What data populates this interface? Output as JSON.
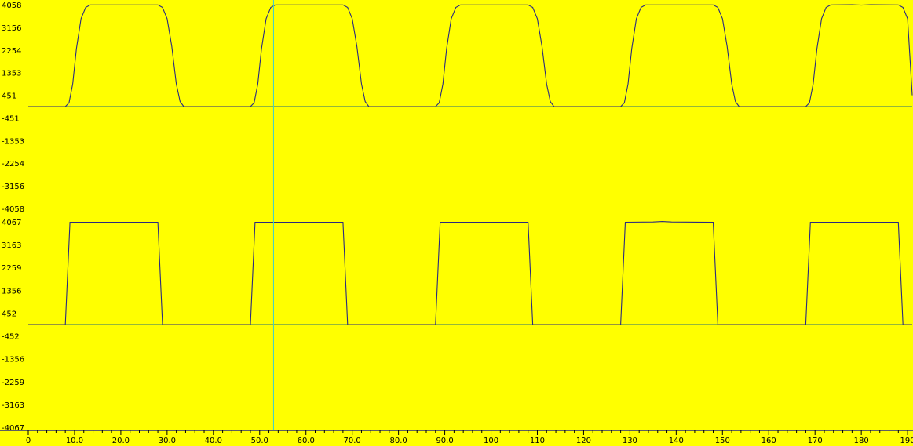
{
  "chart_data": {
    "type": "line",
    "x": {
      "range": [
        0,
        191
      ],
      "ticks": [
        0,
        10,
        20,
        30,
        40,
        50,
        60,
        70,
        80,
        90,
        100,
        110,
        120,
        130,
        140,
        150,
        160,
        170,
        180,
        190
      ],
      "tick_labels": [
        "0",
        "10.0",
        "20.0",
        "30.0",
        "40.0",
        "50.0",
        "60.0",
        "70.0",
        "80.0",
        "90.0",
        "100",
        "110",
        "120",
        "130",
        "140",
        "150",
        "160",
        "170",
        "180",
        "190"
      ]
    },
    "cursor_x": 53,
    "panels": [
      {
        "ylim": [
          -4058,
          4058
        ],
        "yticks": [
          4058,
          3156,
          2254,
          1353,
          451,
          -451,
          -1353,
          -2254,
          -3156,
          -4058
        ],
        "ytick_labels": [
          "4058",
          "3156",
          "2254",
          "1353",
          "451",
          "-451",
          "-1353",
          "-2254",
          "-3156",
          "-4058"
        ],
        "series": [
          {
            "color": "#2a2a80",
            "points": [
              [
                0,
                0
              ],
              [
                8,
                0
              ],
              [
                8.8,
                150
              ],
              [
                9.6,
                900
              ],
              [
                10.4,
                2300
              ],
              [
                11.4,
                3500
              ],
              [
                12.4,
                3950
              ],
              [
                13.4,
                4050
              ],
              [
                28,
                4050
              ],
              [
                29,
                3950
              ],
              [
                30,
                3500
              ],
              [
                31,
                2400
              ],
              [
                32,
                900
              ],
              [
                32.8,
                200
              ],
              [
                33.6,
                0
              ],
              [
                48,
                0
              ],
              [
                48.8,
                150
              ],
              [
                49.6,
                900
              ],
              [
                50.4,
                2300
              ],
              [
                51.4,
                3500
              ],
              [
                52.4,
                3950
              ],
              [
                53.4,
                4050
              ],
              [
                68,
                4050
              ],
              [
                69,
                3950
              ],
              [
                70,
                3500
              ],
              [
                71,
                2400
              ],
              [
                72,
                900
              ],
              [
                72.8,
                200
              ],
              [
                73.6,
                0
              ],
              [
                88,
                0
              ],
              [
                88.8,
                150
              ],
              [
                89.6,
                900
              ],
              [
                90.4,
                2300
              ],
              [
                91.4,
                3500
              ],
              [
                92.4,
                3950
              ],
              [
                93.4,
                4050
              ],
              [
                108,
                4050
              ],
              [
                109,
                3950
              ],
              [
                110,
                3500
              ],
              [
                111,
                2400
              ],
              [
                112,
                900
              ],
              [
                112.8,
                200
              ],
              [
                113.6,
                0
              ],
              [
                128,
                0
              ],
              [
                128.8,
                150
              ],
              [
                129.6,
                900
              ],
              [
                130.4,
                2300
              ],
              [
                131.4,
                3500
              ],
              [
                132.4,
                3950
              ],
              [
                133.4,
                4050
              ],
              [
                148,
                4050
              ],
              [
                149,
                3950
              ],
              [
                150,
                3500
              ],
              [
                151,
                2400
              ],
              [
                152,
                900
              ],
              [
                152.8,
                200
              ],
              [
                153.6,
                0
              ],
              [
                168,
                0
              ],
              [
                168.8,
                150
              ],
              [
                169.6,
                900
              ],
              [
                170.4,
                2300
              ],
              [
                171.4,
                3500
              ],
              [
                172.4,
                3950
              ],
              [
                173.4,
                4050
              ],
              [
                178,
                4058
              ],
              [
                180,
                4040
              ],
              [
                182,
                4058
              ],
              [
                188,
                4050
              ],
              [
                189,
                3950
              ],
              [
                190,
                3500
              ],
              [
                191,
                450
              ]
            ]
          }
        ]
      },
      {
        "ylim": [
          -4067,
          4067
        ],
        "yticks": [
          4067,
          3163,
          2259,
          1356,
          452,
          -452,
          -1356,
          -2259,
          -3163,
          -4067
        ],
        "ytick_labels": [
          "4067",
          "3163",
          "2259",
          "1356",
          "452",
          "-452",
          "-1356",
          "-2259",
          "-3163",
          "-4067"
        ],
        "series": [
          {
            "color": "#2a2a80",
            "points": [
              [
                0,
                0
              ],
              [
                8,
                0
              ],
              [
                9,
                4050
              ],
              [
                28,
                4050
              ],
              [
                29,
                0
              ],
              [
                48,
                0
              ],
              [
                49,
                4050
              ],
              [
                68,
                4050
              ],
              [
                69,
                0
              ],
              [
                88,
                0
              ],
              [
                89,
                4050
              ],
              [
                108,
                4050
              ],
              [
                109,
                0
              ],
              [
                128,
                0
              ],
              [
                129,
                4050
              ],
              [
                135,
                4060
              ],
              [
                137,
                4080
              ],
              [
                139,
                4060
              ],
              [
                148,
                4050
              ],
              [
                149,
                0
              ],
              [
                168,
                0
              ],
              [
                169,
                4050
              ],
              [
                188,
                4050
              ],
              [
                189,
                0
              ],
              [
                191,
                0
              ]
            ]
          }
        ]
      }
    ]
  }
}
